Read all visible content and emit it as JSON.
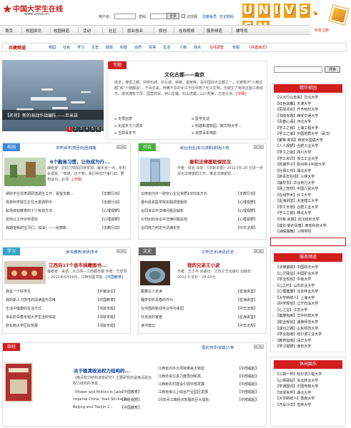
{
  "header": {
    "site_name": "中国大学生在线",
    "site_url": "www.univs.cn",
    "username_label": "用户名：",
    "password_label": "密码：",
    "login_button": "登录",
    "remember_label": "记住我",
    "register_link": "注册会员",
    "forgot_link": "忘记密码",
    "brand_letters": [
      "U",
      "N",
      "I",
      "V",
      "S",
      ".",
      "C",
      "N"
    ],
    "brand_sub": "实名注册"
  },
  "nav": [
    "首页",
    "校园资讯",
    "校园频道",
    "活动",
    "社区",
    "就业创业",
    "原创",
    "在线视频",
    "服务频道",
    "辅导员"
  ],
  "channel": {
    "title": "共建频道",
    "items": [
      "校园",
      "社会",
      "学习",
      "文史",
      "政经",
      "科技",
      "自然",
      "军事",
      "生活",
      "人物",
      "观点",
      "在线调查",
      "专题",
      "《共建通讯》"
    ]
  },
  "hero": {
    "caption_tag": "【名将】",
    "caption": "新的海战作战编队——尼米兹",
    "pages": [
      "1",
      "2",
      "3",
      "4",
      "5",
      "6"
    ]
  },
  "special": {
    "tab": "专题",
    "title": "文化古都——南京",
    "body": "南京，博爱之都，别称石城、石头城、钟陵、金陵等，是中国四大古都之一，又被称为“六朝古都”和“十朝都会”，千百年来，奔腾不息的长江不仅孕育了长江文明，也催生了南京这座江南城市。南京拥有了厚，国营商贸。钟山龙蟠，石头虎踞，山川秀美，古迹众多。",
    "more": "[详细]",
    "bullets": [
      "无限创意",
      "医学支话",
      "化成天下八周年",
      "构建和谐校园，散文明大学...",
      "五四青年节",
      "追梦百年电影"
    ]
  },
  "side": {
    "search_button": "搜索",
    "fine_head": "精华家园",
    "fine_items": [
      "【从大行山走来】华北大学",
      "【红色战鹰】天津大学",
      "【思政评论】齐齐哈尔大学",
      "【书院专题】西安交通大学",
      "【青春心语】河北大学",
      "【学工之窗】上海工程大学",
      "【学工之家】中国地质大学（武汉）",
      "【聚焦·新闻】西安外国语大学",
      "【人人视野】合肥工业大学",
      "【学工之窗】四川大学",
      "【学工资讯】浙江工业大学",
      "【软播学子】杭州电子科技大学",
      "【社情工作】湖北大学",
      "【新青年在线】三峡大学",
      "【辅导员】华北电力大学",
      "【网上党校】中国人民大学",
      "【在线学术】长江大学",
      "【星海讲堂】大连理工大学",
      "【学工天地】合肥工业大学",
      "【学工之窗】西北大学",
      "【印象·武院】武汉纺织大学",
      "【成长·新的青春】西安科技大学",
      "【诗暇偶舞】三明学院"
    ],
    "service_head": "服务频道",
    "service_items": [
      "【法律援助】中国政法大学",
      "【心灵驿站】中国矿业大学",
      "【学业规划】中南大学",
      "【心之约】山东农业大学",
      "【心理健康】北京林业大学",
      "【大学新鲜人】上海大学",
      "【科学规划】辽宁石油大学",
      "【心之宝】江苏大学",
      "【健康指南】华中科技大学",
      "【职业规划】湖南师范大学",
      "【成功之路】山东师范大学",
      "【学业指南】哈尔滨工业大学",
      "【教育指南】清华大学",
      "【学习视野】南京大学"
    ],
    "fun_head": "休闲娱乐",
    "fun_items": [
      "【三袋一杯】哈尔滨工程大学",
      "【心情驿站】东北林业大学",
      "【学通图讯】中国传媒大学",
      "【动漫世界】湖北大学",
      "【大学新鲜人】暨南大学",
      "【汽车沙龙】吉林大学"
    ]
  },
  "campus": {
    "tag": "校园",
    "subnav": "求学|就学|党团|社团|博客",
    "more": "MORE",
    "title": "6个殿易习惯，让你成为行...",
    "desc": "编者按：好的习惯如同存零钱，每天放一点，年积会很富，“知道，还不够；我们得去付诸行动。要想成功，必须...",
    "more_link": "[详细]",
    "items": [
      [
        "胡卯平在甘肃调研选调生工作、看望支教...",
        "【支教行动】"
      ],
      [
        "高校科学院生正在大报调研中",
        "【支教行动】"
      ],
      [
        "职场目标教育的十个有效方法",
        "【心理视野】"
      ],
      [
        "如何让工作伙伴更好",
        "【心理视野】"
      ],
      [
        "我期望我的宝贝们，加油！——张丽新...",
        "【支教行动】"
      ]
    ]
  },
  "society": {
    "tag": "社会",
    "subnav": "就业|创业|实习|求职|职场|人物",
    "more": "MORE",
    "title": "秦和法律援助保民生",
    "desc": "作者：佚名  出处：《法制日报》2012-05-20  为进一步深化法律援助工作，推进法律援助……",
    "items": [
      [
        "云南省内外一院安心企业资质1300余万元",
        "【支教行动】"
      ],
      [
        "晋州县县医学院实践调查服务",
        "【心理视野】"
      ],
      [
        "合同诉讼中法律问题及解析",
        "【心理视野】"
      ],
      [
        "公司纠纷诉讼中法律问题总结",
        "【心理视野】"
      ],
      [
        "合同效力判定与法律实务",
        "【中华法规】"
      ]
    ]
  },
  "study": {
    "tag": "学习",
    "subnav": "读书|教育|考研|学术",
    "more": "MORE",
    "title": "江西向17个县市捐赠图书...",
    "desc": "编者按：来源：大江网—江南都市报 作者：王佳慧 ，2012年6月19日，江西省图书馆...",
    "more_link": "[中国教育]",
    "items": [
      [
        "我是一个好学生",
        "【乡镇诉讼】"
      ],
      [
        "我的新人习惯性的阅读提升思维",
        "【中国教育】"
      ],
      [
        "生活中健康的生活方式",
        "【书院专题】"
      ],
      [
        "多彩的青春专题大学生活好体验",
        "【书院专题】"
      ],
      [
        "黔东南大学区好将报",
        "【书院专题】"
      ]
    ]
  },
  "culture": {
    "tag": "文史",
    "subnav": "文学|艺术|诗词|历史",
    "more": "MORE",
    "title": "我的兄弟王小波",
    "desc": "作者：王小平  出版社：江苏文艺出版社  出版年：2012-5  定价：28.00元",
    "items": [
      [
        "跟着古人走读",
        "【星海讲堂】"
      ],
      [
        "睡梦中的青春的作为",
        "【星海讲堂】"
      ],
      [
        "在中国的新闻专业学与家园",
        "【中华法规】"
      ],
      [
        "托克逊的家谱",
        "【星海讲堂】"
      ],
      [
        "读书笔记",
        "【中华法规】"
      ]
    ]
  },
  "politics": {
    "tag": "政经",
    "subnav": "理论|时评|实践|人物",
    "more": "MORE",
    "title": "关于晚清政治权力结构的...",
    "desc": "《晚清权力结构演变研究》主要研究的是晚清政治权力结构的演变...",
    "items_left": [
      [
        "《Power and Politics in Late",
        "【中国教育】"
      ],
      [
        "Imperial China: Yuan Shi-kai in",
        "【政经视野】"
      ],
      [
        "Beijing and Tianjin,1...",
        "【中国教育】"
      ]
    ],
    "items_right": [
      [
        "江西省内外大项目带来大转型",
        "【中部崛起】"
      ],
      [
        "江西外资引进力度再创新高",
        "【中部崛起】"
      ],
      [
        "江西新农村建设引领中部发展",
        "【中部崛起】"
      ],
      [
        "江西省级以上综合产业园区发展",
        "【中部崛起】"
      ],
      [
        "10年间江西经济发展的巨大成就",
        "【中部崛起】"
      ]
    ]
  }
}
